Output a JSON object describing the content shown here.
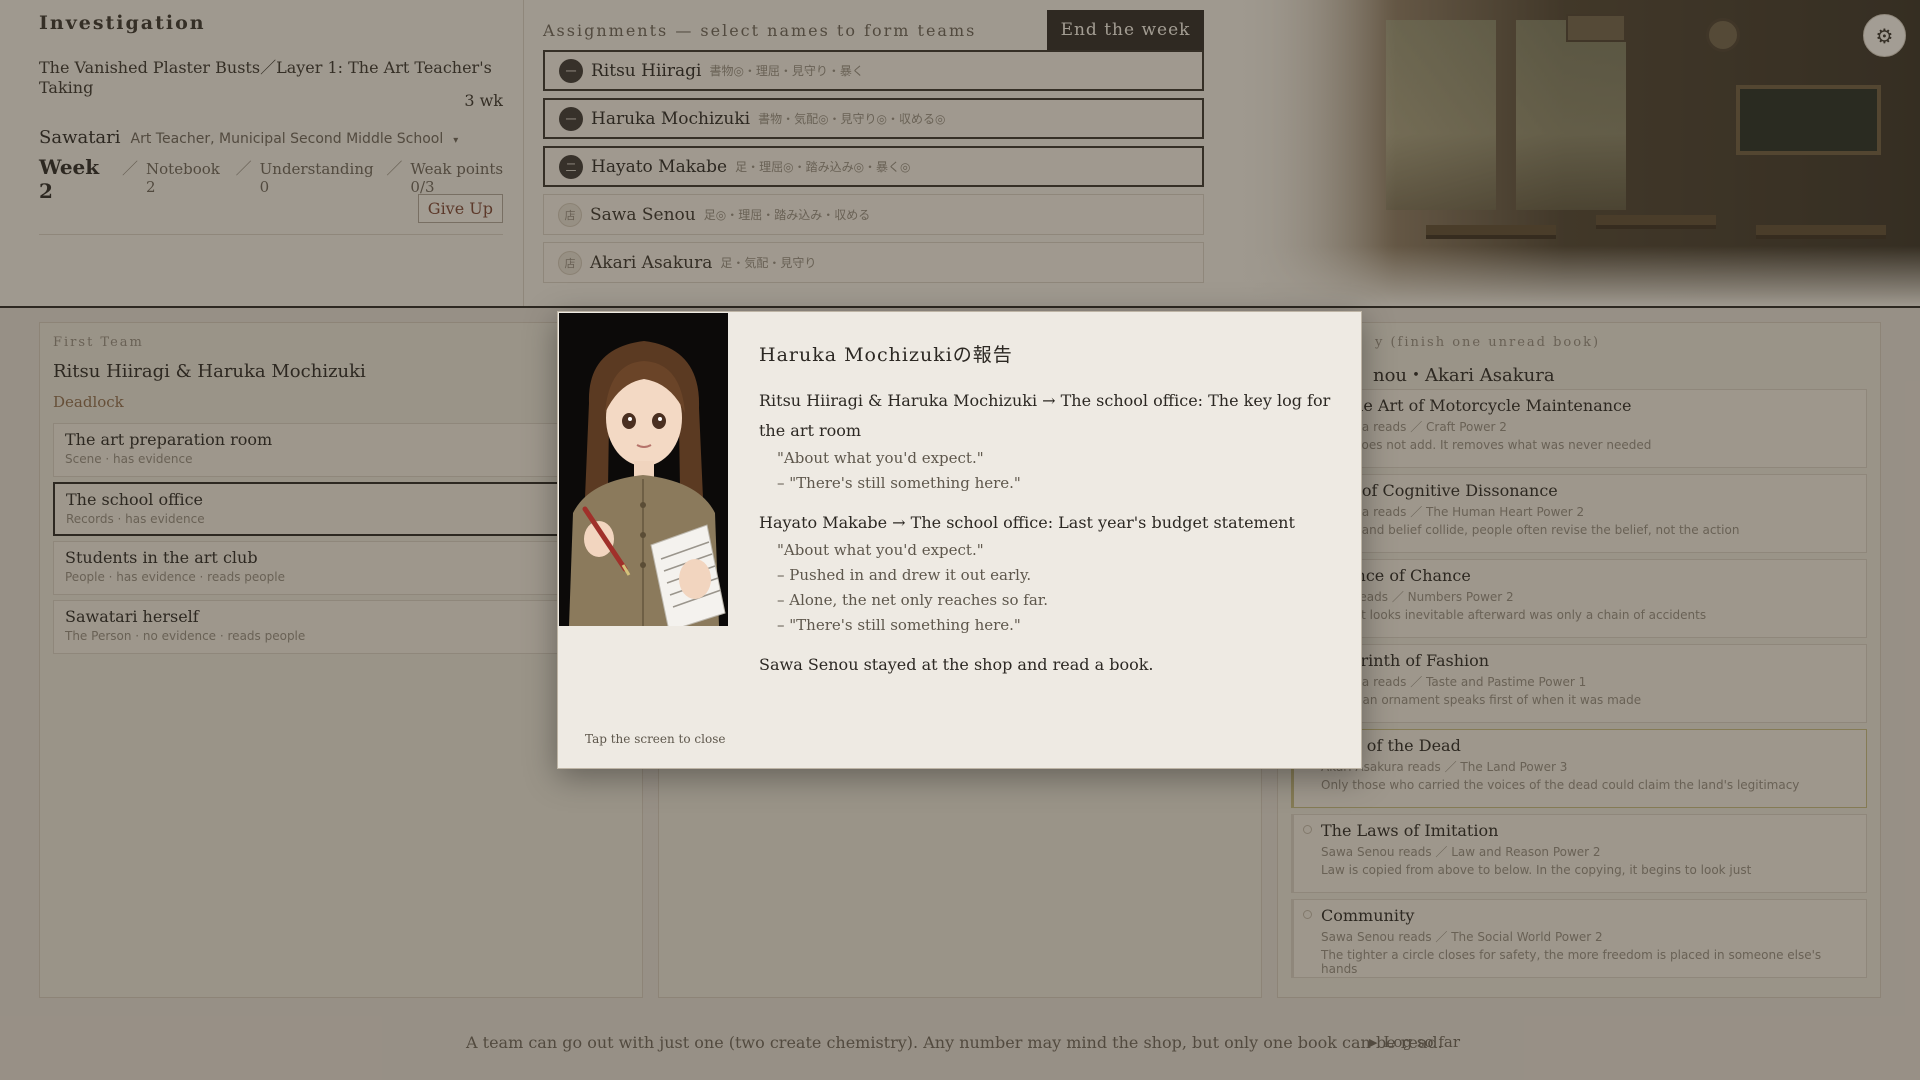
{
  "investigation": {
    "title": "Investigation",
    "case": "The Vanished Plaster Busts／Layer 1: The Art Teacher's Taking",
    "weeks_left": "3 wk",
    "target_name": "Sawatari",
    "target_role": "Art Teacher, Municipal Second Middle School",
    "target_caret": "▾",
    "week": "Week 2",
    "sep": "／",
    "notebook": "Notebook 2",
    "understanding": "Understanding 0",
    "weak_points": "Weak points 0/3",
    "give_up": "Give Up"
  },
  "assignments": {
    "title": "Assignments — select names to form teams",
    "end_week": "End the week",
    "rows": [
      {
        "badge": "一",
        "name": "Ritsu Hiiragi",
        "traits": "書物◎・理屈・見守り・暴く",
        "state": "assigned"
      },
      {
        "badge": "一",
        "name": "Haruka Mochizuki",
        "traits": "書物・気配◎・見守り◎・収める◎",
        "state": "assigned"
      },
      {
        "badge": "二",
        "name": "Hayato Makabe",
        "traits": "足・理屈◎・踏み込み◎・暴く◎",
        "state": "assigned"
      },
      {
        "badge": "店",
        "name": "Sawa Senou",
        "traits": "足◎・理屈・踏み込み・収める",
        "state": "shop"
      },
      {
        "badge": "店",
        "name": "Akari Asakura",
        "traits": "足・気配・見守り",
        "state": "shop"
      }
    ]
  },
  "settings_icon": "⚙",
  "first_team": {
    "eyebrow": "First Team",
    "members": "Ritsu Hiiragi & Haruka Mochizuki",
    "status": "Deadlock",
    "destinations": [
      {
        "name": "The art preparation room",
        "meta": "Scene · has evidence",
        "selected": false
      },
      {
        "name": "The school office",
        "meta": "Records · has evidence",
        "selected": true
      },
      {
        "name": "Students in the art club",
        "meta": "People · has evidence · reads people",
        "selected": false
      },
      {
        "name": "Sawatari herself",
        "meta": "The Person · no evidence · reads people",
        "selected": false
      }
    ]
  },
  "shop": {
    "eyebrow": "y (finish one unread book)",
    "members": "nou・Akari Asakura",
    "books": [
      {
        "title": "nd the Art of Motorcycle Maintenance",
        "reader": "Asakura reads ／ Craft Power 2",
        "quote": "work does not add. It removes what was never needed",
        "highlight": false
      },
      {
        "title": "eory of Cognitive Dissonance",
        "reader": "Asakura reads ／ The Human Heart Power 2",
        "quote": "action and belief collide, people often revise the belief, not the action",
        "highlight": false
      },
      {
        "title": "Science of Chance",
        "reader": "enou reads ／ Numbers Power 2",
        "quote": "of what looks inevitable afterward was only a chain of accidents",
        "highlight": false
      },
      {
        "title": "Labyrinth of Fashion",
        "reader": "Asakura reads ／ Taste and Pastime Power 1",
        "quote": "ape of an ornament speaks first of when it was made",
        "highlight": false
      },
      {
        "title": "Book of the Dead",
        "reader": "Akari Asakura reads ／ The Land Power 3",
        "quote": "Only those who carried the voices of the dead could claim the land's legitimacy",
        "highlight": true
      },
      {
        "title": "The Laws of Imitation",
        "reader": "Sawa Senou reads ／ Law and Reason Power 2",
        "quote": "Law is copied from above to below. In the copying, it begins to look just",
        "highlight": false
      },
      {
        "title": "Community",
        "reader": "Sawa Senou reads ／ The Social World Power 2",
        "quote": "The tighter a circle closes for safety, the more freedom is placed in someone else's hands",
        "highlight": false
      }
    ]
  },
  "footer": {
    "note": "A team can go out with just one (two create chemistry). Any number may mind the shop, but only one book can be read.",
    "log_icon": "▶",
    "log": "Log so far"
  },
  "modal": {
    "title": "Haruka Mochizukiの報告",
    "line1": "Ritsu Hiiragi & Haruka Mochizuki → The school office: The key log for the art room",
    "line1_subs": [
      "\"About what you'd expect.\"",
      "– \"There's still something here.\""
    ],
    "line2": "Hayato Makabe → The school office: Last year's budget statement",
    "line2_subs": [
      "\"About what you'd expect.\"",
      "– Pushed in and drew it out early.",
      "– Alone, the net only reaches so far.",
      "– \"There's still something here.\""
    ],
    "line3": "Sawa Senou stayed at the shop and read a book.",
    "close_hint": "Tap the screen to close"
  }
}
